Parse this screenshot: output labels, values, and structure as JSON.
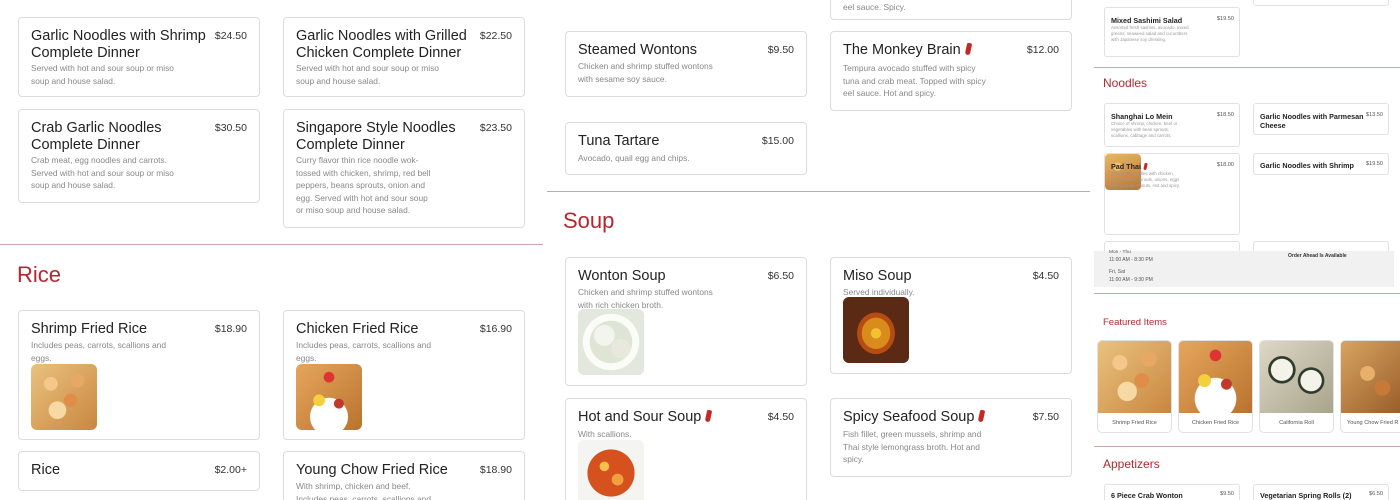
{
  "panel1": {
    "cards": [
      {
        "name": "Garlic Noodles with Shrimp Complete Dinner",
        "price": "$24.50",
        "desc": "Served with hot and sour soup or miso soup and house salad."
      },
      {
        "name": "Garlic Noodles with Grilled Chicken Complete Dinner",
        "price": "$22.50",
        "desc": "Served with hot and sour soup or miso soup and house salad."
      },
      {
        "name": "Crab Garlic Noodles Complete Dinner",
        "price": "$30.50",
        "desc": "Crab meat, egg noodles and carrots. Served with hot and sour soup or miso soup and house salad."
      },
      {
        "name": "Singapore Style Noodles Complete Dinner",
        "price": "$23.50",
        "desc": "Curry flavor thin rice noodle wok-tossed with chicken, shrimp, red bell peppers, beans sprouts, onion and egg. Served with hot and sour soup or miso soup and house salad."
      }
    ],
    "rice_title": "Rice",
    "rice_cards": [
      {
        "name": "Shrimp Fried Rice",
        "price": "$18.90",
        "desc": "Includes peas, carrots, scallions and eggs."
      },
      {
        "name": "Chicken Fried Rice",
        "price": "$16.90",
        "desc": "Includes peas, carrots, scallions and eggs."
      },
      {
        "name": "Rice",
        "price": "$2.00+",
        "desc": ""
      },
      {
        "name": "Young Chow Fried Rice",
        "price": "$18.90",
        "desc": "With shrimp, chicken and beef. Includes peas, carrots, scallions and"
      }
    ]
  },
  "panel2": {
    "top_cards": [
      {
        "name": "",
        "price": "",
        "desc": "eel sauce. Spicy."
      },
      {
        "name": "Steamed Wontons",
        "price": "$9.50",
        "desc": "Chicken and shrimp stuffed wontons with sesame soy sauce."
      },
      {
        "name": "The Monkey Brain",
        "price": "$12.00",
        "desc": "Tempura avocado stuffed with spicy tuna and crab meat. Topped with spicy eel sauce. Hot and spicy."
      },
      {
        "name": "Tuna Tartare",
        "price": "$15.00",
        "desc": "Avocado, quail egg and chips."
      }
    ],
    "soup_title": "Soup",
    "soup_cards": [
      {
        "name": "Wonton Soup",
        "price": "$6.50",
        "desc": "Chicken and shrimp stuffed wontons with rich chicken broth."
      },
      {
        "name": "Miso Soup",
        "price": "$4.50",
        "desc": "Served individually."
      },
      {
        "name": "Hot and Sour Soup",
        "price": "$4.50",
        "desc": "With scallions."
      },
      {
        "name": "Spicy Seafood Soup",
        "price": "$7.50",
        "desc": "Fish fillet, green mussels, shrimp and Thai style lemongrass broth. Hot and spicy."
      }
    ]
  },
  "panel3": {
    "sashimi": {
      "name": "Mixed Sashimi Salad",
      "price": "$19.50",
      "desc": "Assorted fresh sashimi, avocado, mixed greens, seaweed salad and cucumbers with Japanese soy dressing."
    },
    "noodles_title": "Noodles",
    "noodles": [
      {
        "name": "Shanghai Lo Mein",
        "price": "$18.50",
        "desc": "Choice of shrimp, chicken, beef or vegetables with bean sprouts, scallions, cabbage and carrots."
      },
      {
        "name": "Garlic Noodles with Parmesan Cheese",
        "price": "$13.50",
        "desc": ""
      },
      {
        "name": "Pad Thai",
        "price": "$18.00",
        "desc": "Thai glass noodles with chicken, shrimp, bean sprouts, onions, eggs and ground peanuts. Hot and spicy."
      },
      {
        "name": "Garlic Noodles with Shrimp",
        "price": "$19.50",
        "desc": ""
      }
    ],
    "hours": {
      "line1_cut": "Mon - Thu",
      "line1_time": "11:00 AM - 8:30 PM",
      "line2": "Fri, Sat",
      "line2_time": "11:00 AM - 9:30 PM",
      "order_ahead": "Order Ahead Is Available"
    },
    "featured_title": "Featured Items",
    "featured": [
      {
        "label": "Shrimp Fried Rice"
      },
      {
        "label": "Chicken Fried Rice"
      },
      {
        "label": "California Roll"
      },
      {
        "label": "Young Chow Fried R"
      }
    ],
    "appetizers_title": "Appetizers",
    "appetizers": [
      {
        "name": "6 Piece Crab Wonton",
        "price": "$9.50"
      },
      {
        "name": "Vegetarian Spring Rolls (2)",
        "price": "$6.50"
      }
    ]
  },
  "colors": {
    "accent": "#b5272d",
    "chili": "#c62828",
    "card_border": "#dcdcdc",
    "divider": "#c9a9a6"
  }
}
